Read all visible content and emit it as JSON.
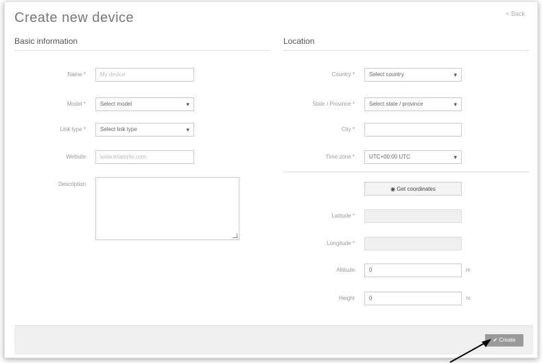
{
  "page": {
    "title": "Create new device",
    "back_label": "< Back"
  },
  "basic": {
    "heading": "Basic information",
    "name": {
      "label": "Name *",
      "placeholder": "My device"
    },
    "model": {
      "label": "Model *",
      "value": "Select model"
    },
    "link_type": {
      "label": "Link type *",
      "value": "Select link type"
    },
    "website": {
      "label": "Website",
      "placeholder": "www.example.com"
    },
    "description": {
      "label": "Description"
    }
  },
  "location": {
    "heading": "Location",
    "country": {
      "label": "Country *",
      "value": "Select country"
    },
    "state": {
      "label": "State / Province *",
      "value": "Select state / province"
    },
    "city": {
      "label": "City *",
      "value": ""
    },
    "time_zone": {
      "label": "Time zone *",
      "value": "UTC+00:00 UTC"
    },
    "get_coords_label": "Get coordinates",
    "latitude": {
      "label": "Latitude *",
      "value": ""
    },
    "longitude": {
      "label": "Longitude *",
      "value": ""
    },
    "altitude": {
      "label": "Altitude",
      "value": "0",
      "unit": "m"
    },
    "height": {
      "label": "Height",
      "value": "0",
      "unit": "m"
    }
  },
  "footer": {
    "create_label": "✔ Create"
  },
  "icons": {
    "cursor": "arrow-cursor-icon",
    "coords": "map-marker-icon"
  }
}
